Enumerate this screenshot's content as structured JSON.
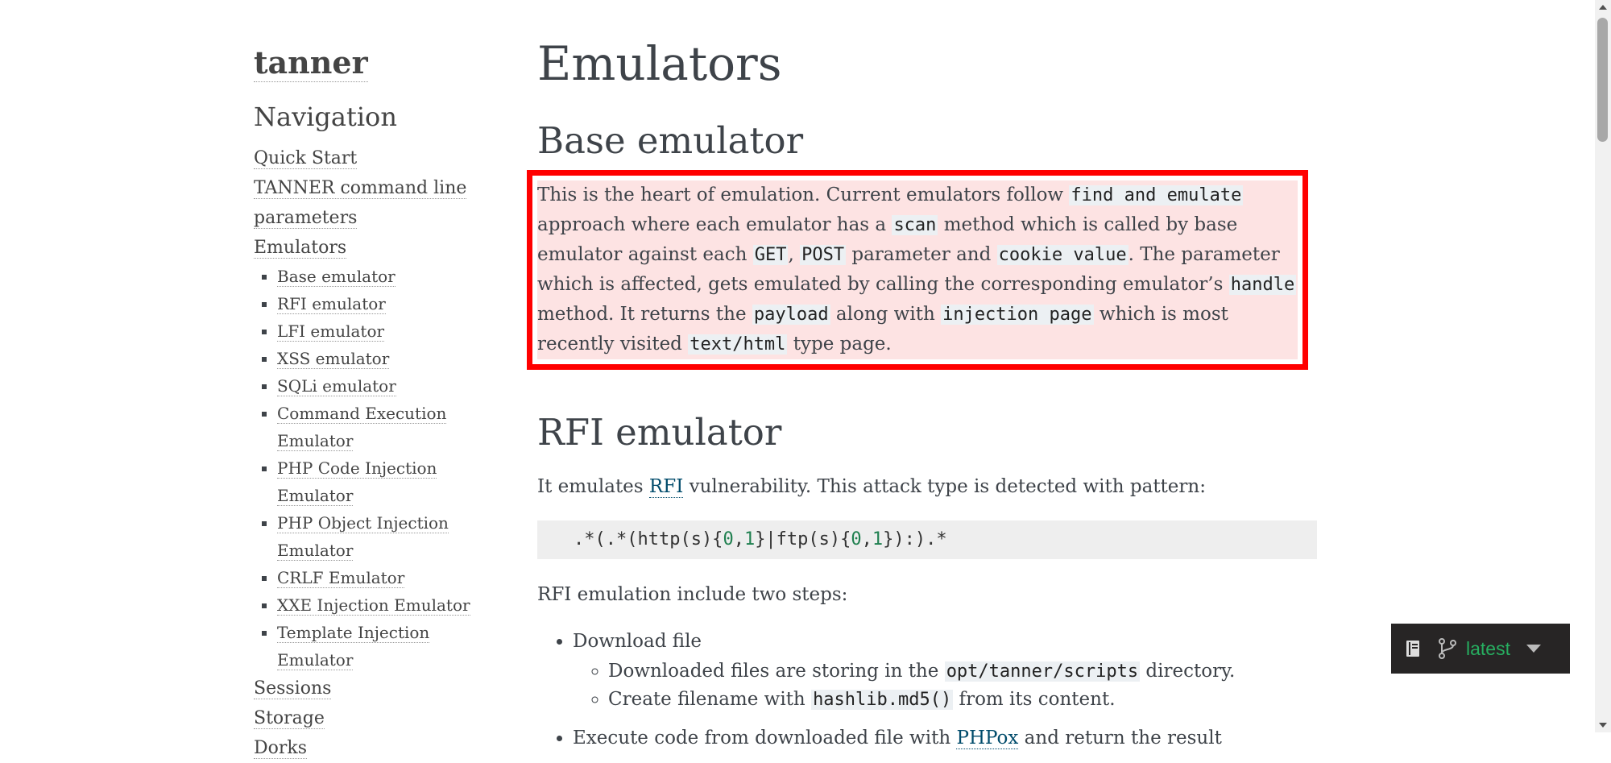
{
  "sidebar": {
    "brand": "tanner",
    "nav_heading": "Navigation",
    "top_items": [
      "Quick Start",
      "TANNER command line parameters",
      "Emulators"
    ],
    "emulator_items": [
      "Base emulator",
      "RFI emulator",
      "LFI emulator",
      "XSS emulator",
      "SQLi emulator",
      "Command Execution Emulator",
      "PHP Code Injection Emulator",
      "PHP Object Injection Emulator",
      "CRLF Emulator",
      "XXE Injection Emulator",
      "Template Injection Emulator"
    ],
    "bottom_items": [
      "Sessions",
      "Storage",
      "Dorks"
    ]
  },
  "main": {
    "title": "Emulators",
    "base": {
      "heading": "Base emulator",
      "t1": "This is the heart of emulation. Current emulators follow ",
      "c1": "find and emulate",
      "t2": " approach where each emulator has a ",
      "c2": "scan",
      "t3": " method which is called by base emulator against each ",
      "c3": "GET",
      "t4": ", ",
      "c4": "POST",
      "t5": " parameter and ",
      "c5": "cookie value",
      "t6": ". The parameter which is affected, gets emulated by calling the corresponding emulator’s ",
      "c6": "handle",
      "t7": " method. It returns the ",
      "c7": "payload",
      "t8": " along with ",
      "c8": "injection page",
      "t9": " which is most recently visited ",
      "c9": "text/html",
      "t10": " type page."
    },
    "rfi": {
      "heading": "RFI emulator",
      "intro_pre": "It emulates ",
      "intro_link": "RFI",
      "intro_post": " vulnerability. This attack type is detected with pattern:",
      "code_a": ".*(.*(http(s){",
      "code_n1": "0",
      "code_b": ",",
      "code_n2": "1",
      "code_c": "}|ftp(s){",
      "code_n3": "0",
      "code_d": ",",
      "code_n4": "1",
      "code_e": "}):).*",
      "steps_intro": "RFI emulation include two steps:",
      "step1": "Download file",
      "step1_sub1_pre": "Downloaded files are storing in the ",
      "step1_sub1_code": "opt/tanner/scripts",
      "step1_sub1_post": " directory.",
      "step1_sub2_pre": "Create filename with ",
      "step1_sub2_code": "hashlib.md5()",
      "step1_sub2_post": " from its content.",
      "step2_pre": "Execute code from downloaded file with ",
      "step2_link": "PHPox",
      "step2_post": " and return the result"
    }
  },
  "flyout": {
    "version": "latest",
    "color": "#27ae60"
  },
  "highlight_color": "#ff0000"
}
